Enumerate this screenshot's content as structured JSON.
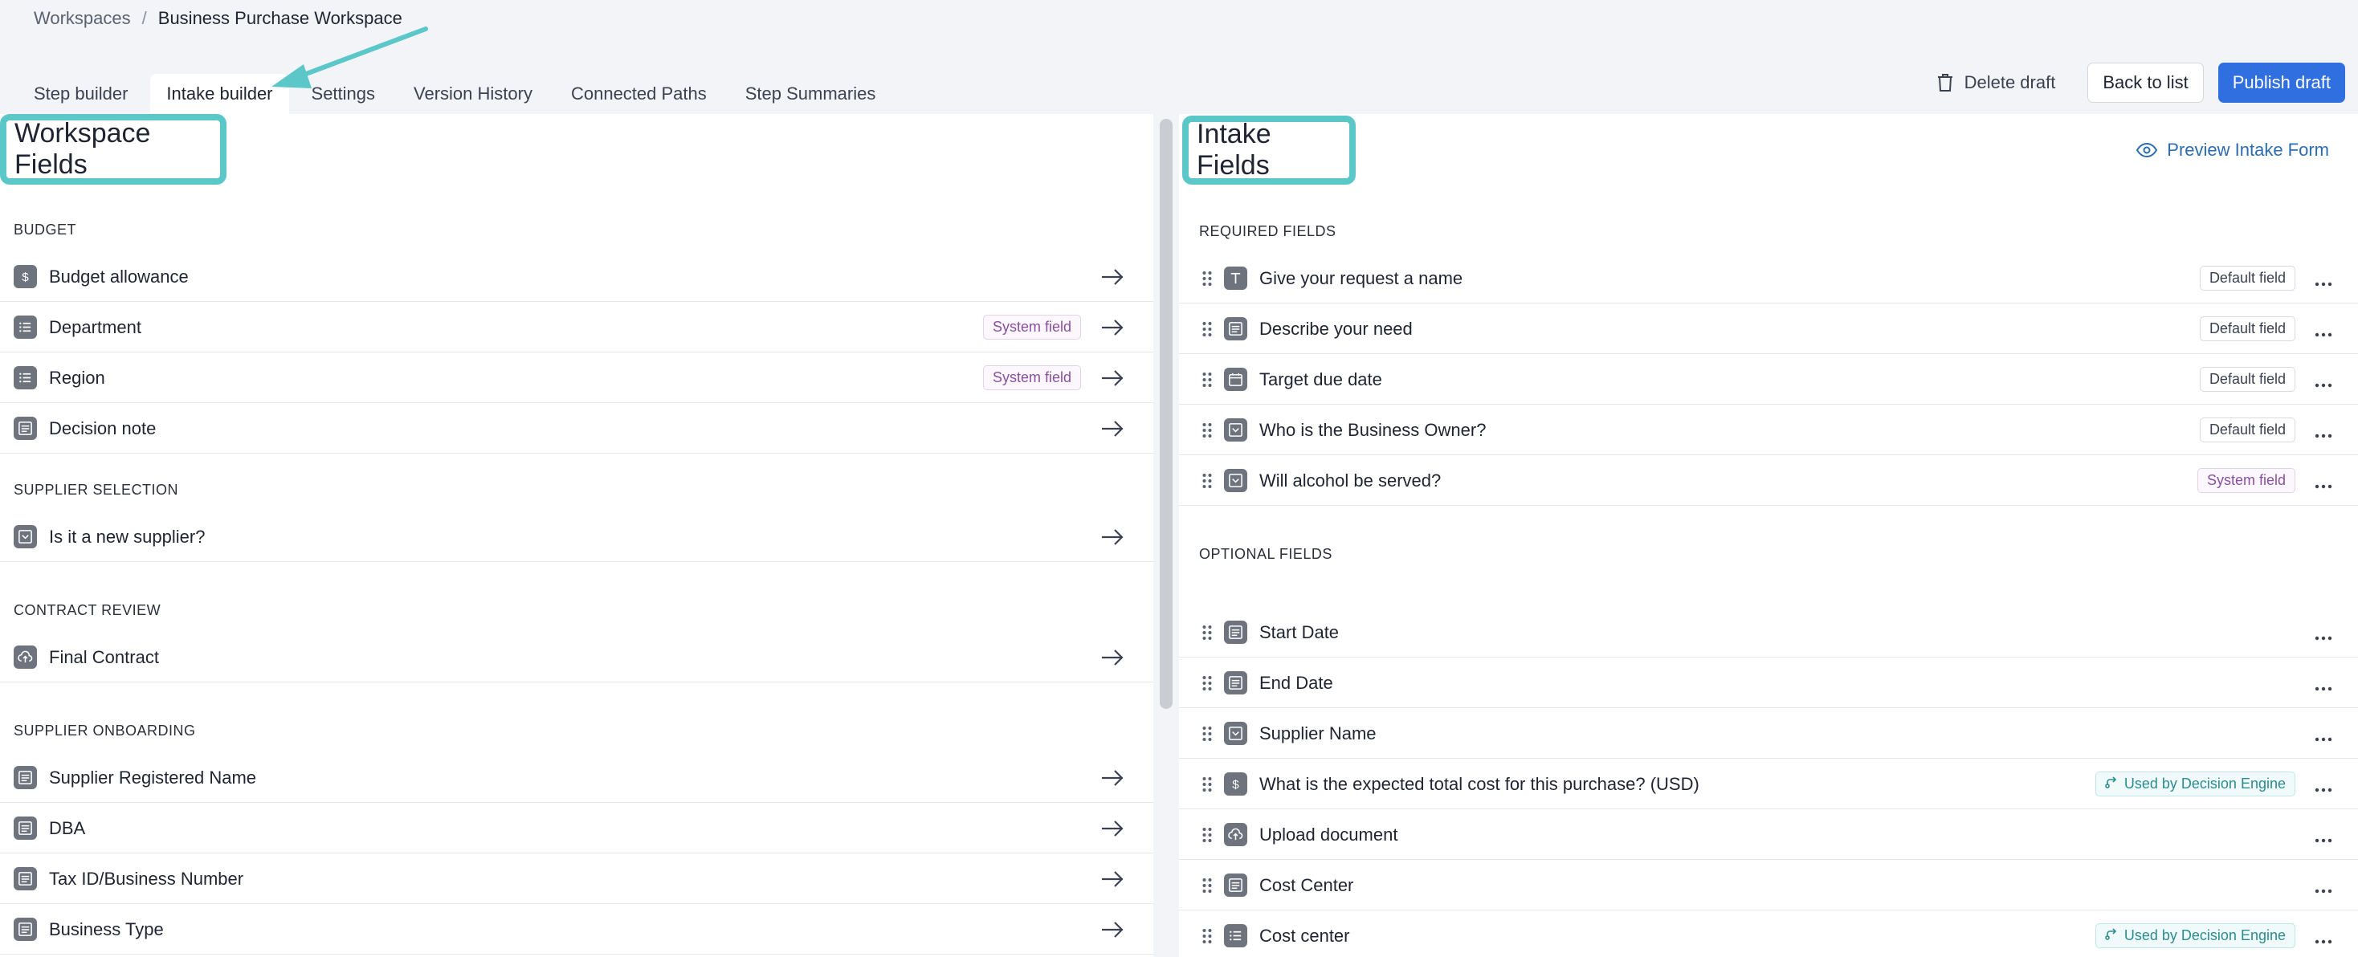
{
  "breadcrumb": {
    "root": "Workspaces",
    "separator": "/",
    "current": "Business Purchase Workspace"
  },
  "tabs": [
    {
      "label": "Step builder"
    },
    {
      "label": "Intake builder"
    },
    {
      "label": "Settings"
    },
    {
      "label": "Version History"
    },
    {
      "label": "Connected Paths"
    },
    {
      "label": "Step Summaries"
    }
  ],
  "active_tab": "Intake builder",
  "actions": {
    "delete": "Delete draft",
    "back": "Back to list",
    "publish": "Publish draft"
  },
  "colors": {
    "accent": "#2f6fe0",
    "highlight": "#5cc7c9",
    "system_badge": "#8a4f9e",
    "engine_badge": "#2b8c8f"
  },
  "left": {
    "title": "Workspace Fields",
    "sections": [
      {
        "heading": "BUDGET",
        "items": [
          {
            "label": "Budget allowance",
            "icon": "dollar-icon",
            "badge": ""
          },
          {
            "label": "Department",
            "icon": "list-icon",
            "badge": "System field"
          },
          {
            "label": "Region",
            "icon": "list-icon",
            "badge": "System field"
          },
          {
            "label": "Decision note",
            "icon": "text-area-icon",
            "badge": ""
          }
        ]
      },
      {
        "heading": "SUPPLIER SELECTION",
        "items": [
          {
            "label": "Is it a new supplier?",
            "icon": "dropdown-icon",
            "badge": ""
          }
        ]
      },
      {
        "heading": "CONTRACT REVIEW",
        "items": [
          {
            "label": "Final Contract",
            "icon": "upload-icon",
            "badge": ""
          }
        ]
      },
      {
        "heading": "SUPPLIER ONBOARDING",
        "items": [
          {
            "label": "Supplier Registered Name",
            "icon": "text-area-icon",
            "badge": ""
          },
          {
            "label": "DBA",
            "icon": "text-area-icon",
            "badge": ""
          },
          {
            "label": "Tax ID/Business Number",
            "icon": "text-area-icon",
            "badge": ""
          },
          {
            "label": "Business Type",
            "icon": "text-area-icon",
            "badge": ""
          }
        ]
      }
    ]
  },
  "right": {
    "title": "Intake Fields",
    "preview": "Preview Intake Form",
    "required_heading": "REQUIRED FIELDS",
    "required": [
      {
        "label": "Give your request a name",
        "icon": "text-icon",
        "badge": "Default field",
        "badge_type": "default"
      },
      {
        "label": "Describe your need",
        "icon": "text-area-icon",
        "badge": "Default field",
        "badge_type": "default"
      },
      {
        "label": "Target due date",
        "icon": "calendar-icon",
        "badge": "Default field",
        "badge_type": "default"
      },
      {
        "label": "Who is the Business Owner?",
        "icon": "dropdown-icon",
        "badge": "Default field",
        "badge_type": "default"
      },
      {
        "label": "Will alcohol be served?",
        "icon": "dropdown-icon",
        "badge": "System field",
        "badge_type": "system"
      }
    ],
    "optional_heading": "OPTIONAL FIELDS",
    "optional": [
      {
        "label": "Start Date",
        "icon": "text-area-icon",
        "badge": "",
        "badge_type": ""
      },
      {
        "label": "End Date",
        "icon": "text-area-icon",
        "badge": "",
        "badge_type": ""
      },
      {
        "label": "Supplier Name",
        "icon": "dropdown-icon",
        "badge": "",
        "badge_type": ""
      },
      {
        "label": "What is the expected total cost for this purchase? (USD)",
        "icon": "dollar-icon",
        "badge": "Used by Decision Engine",
        "badge_type": "engine"
      },
      {
        "label": "Upload document",
        "icon": "upload-icon",
        "badge": "",
        "badge_type": ""
      },
      {
        "label": "Cost Center",
        "icon": "text-area-icon",
        "badge": "",
        "badge_type": ""
      },
      {
        "label": "Cost center",
        "icon": "list-icon",
        "badge": "Used by Decision Engine",
        "badge_type": "engine"
      }
    ]
  }
}
